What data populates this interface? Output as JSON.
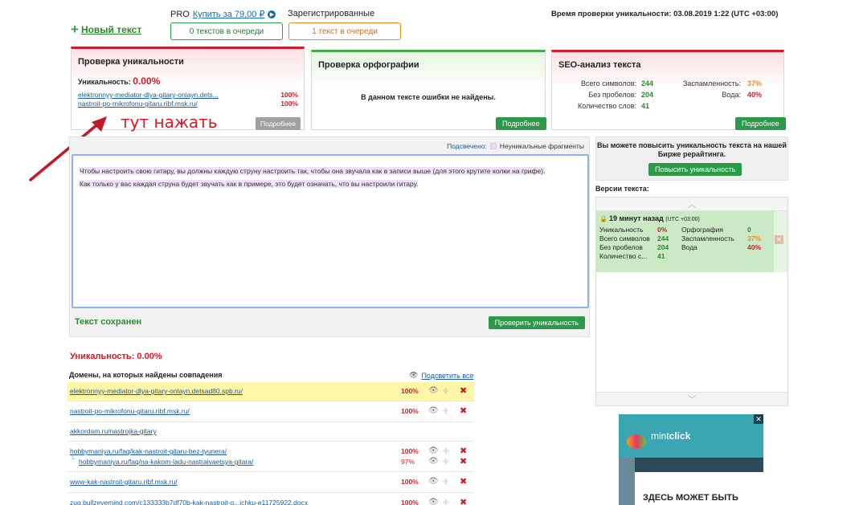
{
  "header": {
    "new_text": "Новый текст",
    "pro_label": "PRO",
    "pro_buy": "Купить за 79,00 ₽",
    "registered": "Зарегистрированные",
    "queue_free": "0 текстов в очереди",
    "queue_registered": "1 текст в очереди",
    "check_time": "Время проверки уникальности: 03.08.2019 1:22 (UTC +03:00)"
  },
  "panels": {
    "uniqueness": {
      "title": "Проверка уникальности",
      "label": "Уникальность:",
      "value": "0.00%",
      "sources": [
        {
          "url": "elektronnyy-mediator-dlya-gitary-onlayn.dets...",
          "pct": "100%"
        },
        {
          "url": "nastroit-po-mikrofonu-gitaru.ribf.msk.ru/",
          "pct": "100%"
        }
      ],
      "more": "Подробнее"
    },
    "spelling": {
      "title": "Проверка орфографии",
      "message": "В данном тексте ошибки не найдены.",
      "more": "Подробнее"
    },
    "seo": {
      "title": "SEO-анализ текста",
      "rows": [
        {
          "k1": "Всего символов:",
          "v1": "244",
          "k2": "Заспамленность:",
          "v2": "37%"
        },
        {
          "k1": "Без пробелов:",
          "v1": "204",
          "k2": "Вода:",
          "v2": "40%"
        },
        {
          "k1": "Количество слов:",
          "v1": "41",
          "k2": "",
          "v2": ""
        }
      ],
      "more": "Подробнее"
    }
  },
  "annotation": "тут нажать",
  "editor": {
    "highlight_label": "Подсвечено:",
    "highlight_legend": "Неуникальные фрагменты",
    "text_line1": "Чтобы настроить свою гитару, вы должны каждую струну настроить так, чтобы она звучала как в записи выше (для этого крутите колки на грифе).",
    "text_line2": "Как только у вас каждая струна будет звучать как в примере, это будет означать, что вы настроили гитару.",
    "saved": "Текст сохранен",
    "check_button": "Проверить уникальность"
  },
  "sidebar": {
    "promo_text": "Вы можете повысить уникальность текста на нашей Бирже рерайтинга.",
    "promo_button": "Повысить уникальность",
    "versions_title": "Версии текста:",
    "version": {
      "time": "19 минут назад",
      "tz": "(UTC +03:00)",
      "rows": [
        {
          "k1": "Уникальность",
          "v1": "0%",
          "k2": "Орфография",
          "v2": "0"
        },
        {
          "k1": "Всего символов",
          "v1": "244",
          "k2": "Заспамленность",
          "v2": "37%"
        },
        {
          "k1": "Без пробелов",
          "v1": "204",
          "k2": "Вода",
          "v2": "40%"
        },
        {
          "k1": "Количество с...",
          "v1": "41",
          "k2": "",
          "v2": ""
        }
      ]
    }
  },
  "results": {
    "uniqueness": "Уникальность: 0.00%",
    "domains_title": "Домены, на которых найдены совпадения",
    "highlight_all": "Подсветить все",
    "rows": [
      {
        "lines": [
          {
            "url": "elektronnyy-mediator-dlya-gitary-onlayn.detsad80.spb.ru/",
            "pct": "100%"
          }
        ],
        "highlighted": true
      },
      {
        "lines": [
          {
            "url": "nastroit-po-mikrofonu-gitaru.ribf.msk.ru/",
            "pct": "100%"
          }
        ]
      },
      {
        "lines": [
          {
            "url": "akkordam.ru/nastrojka-gitary",
            "pct": ""
          }
        ]
      },
      {
        "lines": [
          {
            "url": "hobbymaniya.ru/faq/kak-nastroit-gitaru-bez-tyunera/",
            "pct": "100%"
          },
          {
            "url": "hobbymaniya.ru/faq/na-kakom-ladu-nastraivaetsya-gitara/",
            "pct": "97%",
            "sub": true
          }
        ]
      },
      {
        "lines": [
          {
            "url": "www-kak-nastroit-gitaru.ribf.msk.ru/",
            "pct": "100%"
          }
        ]
      },
      {
        "lines": [
          {
            "url": "zug.bullzeyemind.com/c133333b7df70b-kak-nastroit-g...ichku-e11725922.docx",
            "pct": "100%"
          }
        ]
      }
    ]
  },
  "ad": {
    "brand_a": "mint",
    "brand_b": "click",
    "headline": "ЗДЕСЬ МОЖЕТ БЫТЬ",
    "close": "✕"
  },
  "colors": {
    "red": "#d31a2a",
    "green": "#2a9a48",
    "orange": "#e8901a"
  }
}
